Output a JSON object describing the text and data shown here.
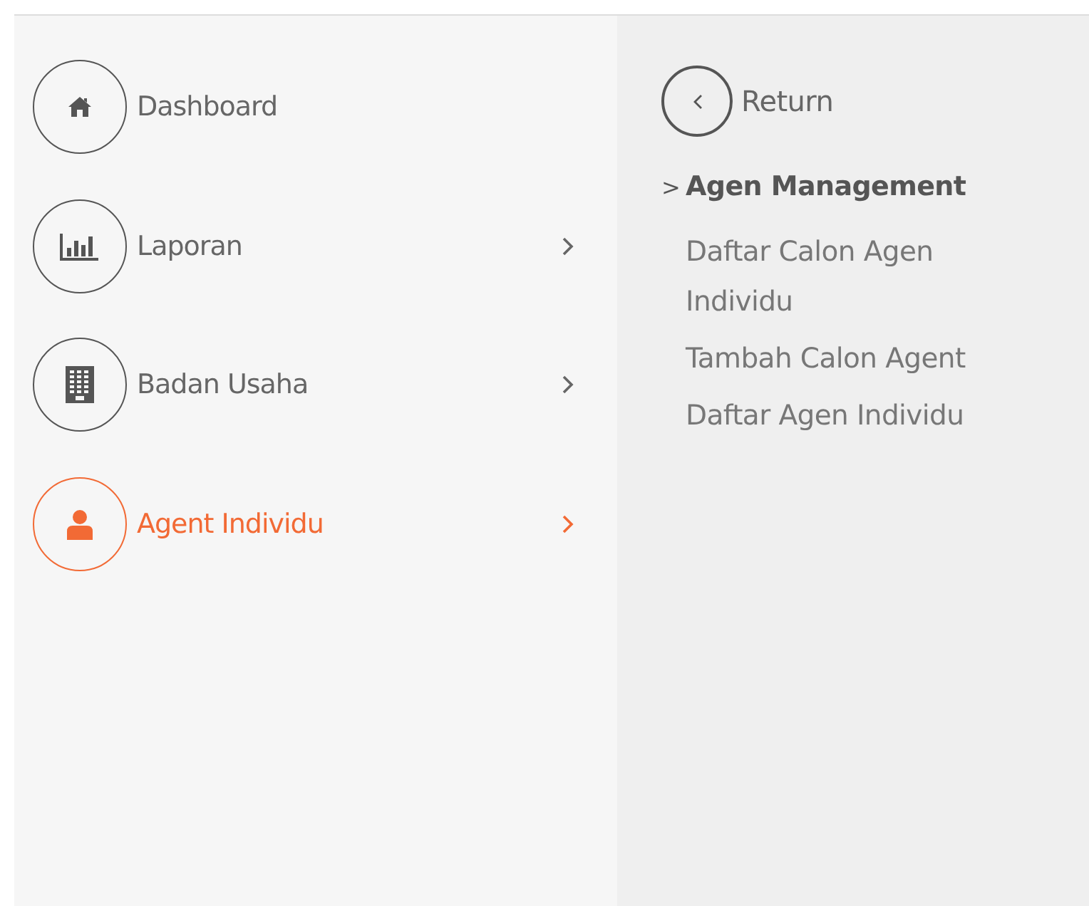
{
  "menu": [
    {
      "label": "Dashboard",
      "has_submenu": false,
      "selected": false
    },
    {
      "label": "Laporan",
      "has_submenu": true,
      "selected": false
    },
    {
      "label": "Badan Usaha",
      "has_submenu": true,
      "selected": false
    },
    {
      "label": "Agent Individu",
      "has_submenu": true,
      "selected": true
    }
  ],
  "submenu": {
    "return_label": "Return",
    "heading": "Agen Management",
    "heading_marker": ">",
    "items": [
      "Daftar Calon Agen Individu",
      "Tambah Calon Agent",
      "Daftar Agen Individu"
    ]
  }
}
